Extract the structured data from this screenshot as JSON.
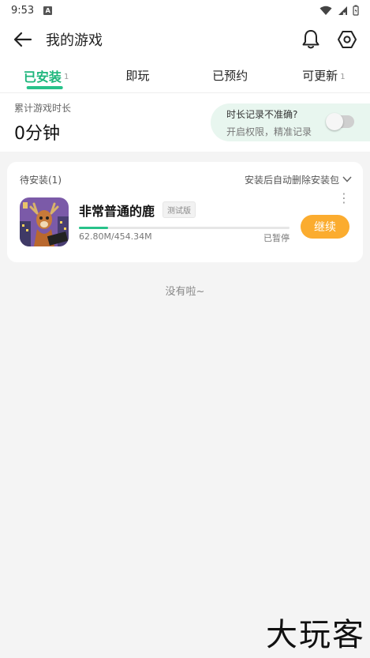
{
  "status_bar": {
    "time": "9:53",
    "notif_badge": "A"
  },
  "header": {
    "title": "我的游戏"
  },
  "tabs": [
    {
      "label": "已安装",
      "count": "1"
    },
    {
      "label": "即玩",
      "count": ""
    },
    {
      "label": "已预约",
      "count": ""
    },
    {
      "label": "可更新",
      "count": "1"
    }
  ],
  "playtime": {
    "label": "累计游戏时长",
    "value": "0分钟"
  },
  "notice": {
    "title": "时长记录不准确?",
    "subtitle": "开启权限，精准记录",
    "toggle_on": false
  },
  "pending": {
    "title": "待安装(1)",
    "auto_delete_label": "安装后自动删除安装包",
    "game": {
      "name": "非常普通的鹿",
      "tag": "测试版",
      "downloaded": "62.80M/454.34M",
      "progress": 0.138,
      "status": "已暂停",
      "action_label": "继续",
      "more_icon": "more-vertical-icon"
    }
  },
  "footer_text": "没有啦~",
  "watermark": "大玩客",
  "colors": {
    "accent": "#28c28a",
    "button": "#fbac2f",
    "notice_bg": "#e8f6ef"
  }
}
